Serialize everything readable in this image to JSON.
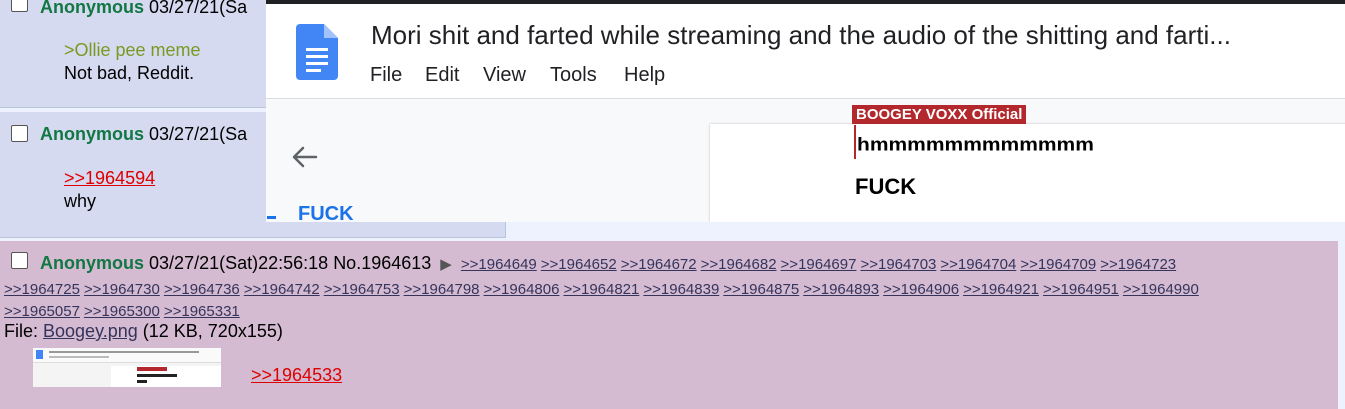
{
  "post1": {
    "name": "Anonymous",
    "date": "03/27/21(Sa",
    "quote_text": ">Ollie pee meme",
    "body_text": "Not bad, Reddit."
  },
  "post2": {
    "name": "Anonymous",
    "date": "03/27/21(Sa",
    "reply_link": ">>1964594",
    "body_text": "why"
  },
  "gdoc": {
    "title": "Mori shit and farted while streaming and the audio of the shitting and farti...",
    "menu": [
      "File",
      "Edit",
      "View",
      "Tools",
      "Help"
    ],
    "outline_item": "FUCK",
    "cursor_label": "BOOGEY VOXX Official",
    "doc_line1": "hmmmmmmmmmmmm",
    "doc_line2": "FUCK"
  },
  "post3": {
    "name": "Anonymous",
    "datetime": "03/27/21(Sat)22:56:18",
    "post_no": "No.1964613",
    "backlinks": [
      ">>1964649",
      ">>1964652",
      ">>1964672",
      ">>1964682",
      ">>1964697",
      ">>1964703",
      ">>1964704",
      ">>1964709",
      ">>1964723",
      ">>1964725",
      ">>1964730",
      ">>1964736",
      ">>1964742",
      ">>1964753",
      ">>1964798",
      ">>1964806",
      ">>1964821",
      ">>1964839",
      ">>1964875",
      ">>1964893",
      ">>1964906",
      ">>1964921",
      ">>1964951",
      ">>1964990",
      ">>1965057",
      ">>1965300",
      ">>1965331"
    ],
    "file_label": "File: ",
    "file_name": "Boogey.png",
    "file_info": " (12 KB, 720x155)",
    "reply_link": ">>1964533"
  },
  "colors": {
    "post_bg": "#d6daf0",
    "highlight_bg": "#d5bbd2",
    "name": "#117743",
    "quote": "#789922",
    "reply_link": "#dd0000",
    "docs_blue": "#4285f4",
    "cursor_label_bg": "#b3282d"
  },
  "icons": [
    "checkbox-icon",
    "google-docs-icon",
    "back-arrow-icon",
    "arrow-right-icon"
  ]
}
